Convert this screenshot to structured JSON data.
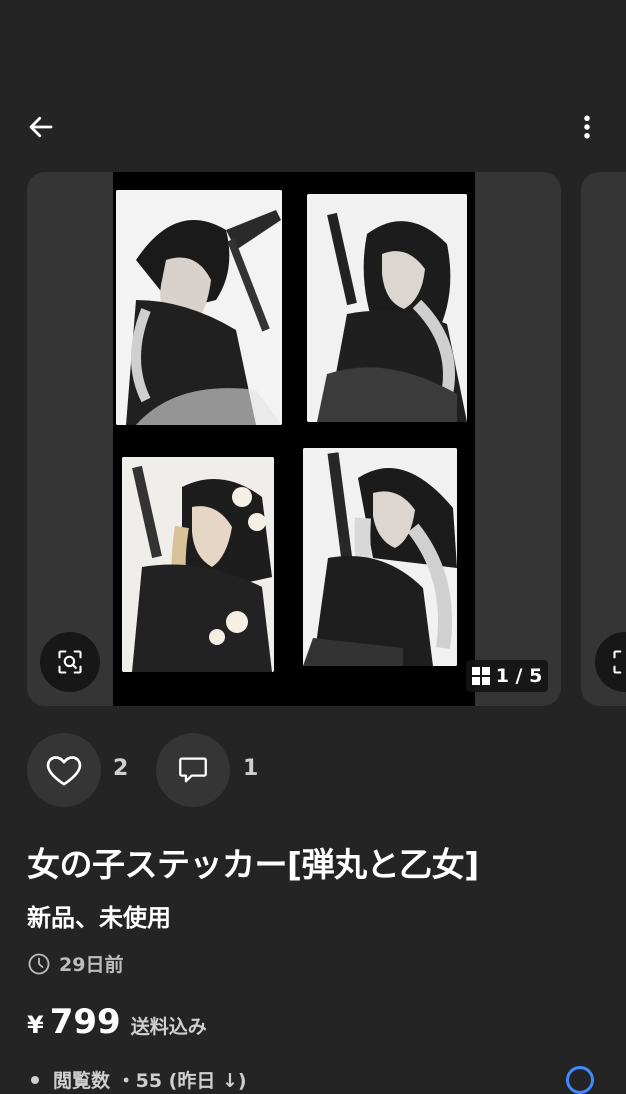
{
  "header": {
    "back_icon": "arrow-left-icon",
    "more_icon": "more-vertical-icon"
  },
  "gallery": {
    "counter": "1 / 5",
    "current": 1,
    "total": 5
  },
  "actions": {
    "like_count": "2",
    "comment_count": "1"
  },
  "item": {
    "title": "女の子ステッカー[弾丸と乙女]",
    "condition": "新品、未使用",
    "posted": "29日前",
    "currency": "¥",
    "price": "799",
    "tax_note": "送料込み"
  },
  "stats": {
    "views_text": "閲覧数 ・55 (昨日 ↓)"
  },
  "colors": {
    "background": "#242424",
    "card": "#353535",
    "accent_info": "#3d8bff"
  }
}
